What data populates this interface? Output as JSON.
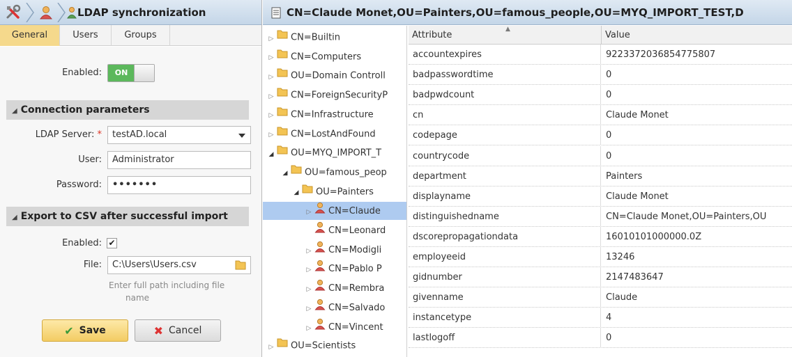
{
  "left": {
    "title": "LDAP synchronization",
    "tabs": [
      {
        "label": "General",
        "active": true
      },
      {
        "label": "Users",
        "active": false
      },
      {
        "label": "Groups",
        "active": false
      }
    ],
    "enabled": {
      "label": "Enabled:",
      "state": "ON"
    },
    "connection": {
      "heading": "Connection parameters",
      "server_label": "LDAP Server:",
      "server_required_mark": "*",
      "server_value": "testAD.local",
      "user_label": "User:",
      "user_value": "Administrator",
      "password_label": "Password:",
      "password_value": "•••••••"
    },
    "export": {
      "heading": "Export to CSV after successful import",
      "enabled_label": "Enabled:",
      "enabled_checked": "✔",
      "file_label": "File:",
      "file_value": "C:\\Users\\Users.csv",
      "hint_line1": "Enter full path including file",
      "hint_line2": "name"
    },
    "buttons": {
      "save": "Save",
      "cancel": "Cancel"
    }
  },
  "right": {
    "header_title": "CN=Claude Monet,OU=Painters,OU=famous_people,OU=MYQ_IMPORT_TEST,D",
    "tree": [
      {
        "label": "CN=Builtin",
        "type": "folder",
        "expanded": false
      },
      {
        "label": "CN=Computers",
        "type": "folder",
        "expanded": false
      },
      {
        "label": "OU=Domain Controll",
        "type": "folder",
        "expanded": false
      },
      {
        "label": "CN=ForeignSecurityP",
        "type": "folder",
        "expanded": false
      },
      {
        "label": "CN=Infrastructure",
        "type": "folder",
        "expanded": false
      },
      {
        "label": "CN=LostAndFound",
        "type": "folder",
        "expanded": false
      },
      {
        "label": "OU=MYQ_IMPORT_T",
        "type": "folder",
        "expanded": true
      },
      {
        "label": "OU=famous_peop",
        "type": "folder",
        "expanded": true
      },
      {
        "label": "OU=Painters",
        "type": "folder",
        "expanded": true
      },
      {
        "label": "CN=Claude",
        "type": "user",
        "expanded": false,
        "selected": true
      },
      {
        "label": "CN=Leonard",
        "type": "user",
        "expanded": null
      },
      {
        "label": "CN=Modigli",
        "type": "user",
        "expanded": false
      },
      {
        "label": "CN=Pablo P",
        "type": "user",
        "expanded": false
      },
      {
        "label": "CN=Rembra",
        "type": "user",
        "expanded": false
      },
      {
        "label": "CN=Salvado",
        "type": "user",
        "expanded": false
      },
      {
        "label": "CN=Vincent",
        "type": "user",
        "expanded": false
      },
      {
        "label": "OU=Scientists",
        "type": "folder",
        "expanded": false
      }
    ],
    "grid": {
      "col_attr": "Attribute",
      "col_value": "Value",
      "rows": [
        {
          "attr": "accountexpires",
          "value": "9223372036854775807"
        },
        {
          "attr": "badpasswordtime",
          "value": "0"
        },
        {
          "attr": "badpwdcount",
          "value": "0"
        },
        {
          "attr": "cn",
          "value": "Claude Monet"
        },
        {
          "attr": "codepage",
          "value": "0"
        },
        {
          "attr": "countrycode",
          "value": "0"
        },
        {
          "attr": "department",
          "value": "Painters"
        },
        {
          "attr": "displayname",
          "value": "Claude Monet"
        },
        {
          "attr": "distinguishedname",
          "value": "CN=Claude Monet,OU=Painters,OU"
        },
        {
          "attr": "dscorepropagationdata",
          "value": "16010101000000.0Z"
        },
        {
          "attr": "employeeid",
          "value": "13246"
        },
        {
          "attr": "gidnumber",
          "value": "2147483647"
        },
        {
          "attr": "givenname",
          "value": "Claude"
        },
        {
          "attr": "instancetype",
          "value": "4"
        },
        {
          "attr": "lastlogoff",
          "value": "0"
        }
      ]
    }
  },
  "colors": {
    "accent_tab": "#f5d98c",
    "toggle_on": "#5cb85c",
    "selected_row": "#aecbf0",
    "header_bar": "#c4d6e8"
  }
}
